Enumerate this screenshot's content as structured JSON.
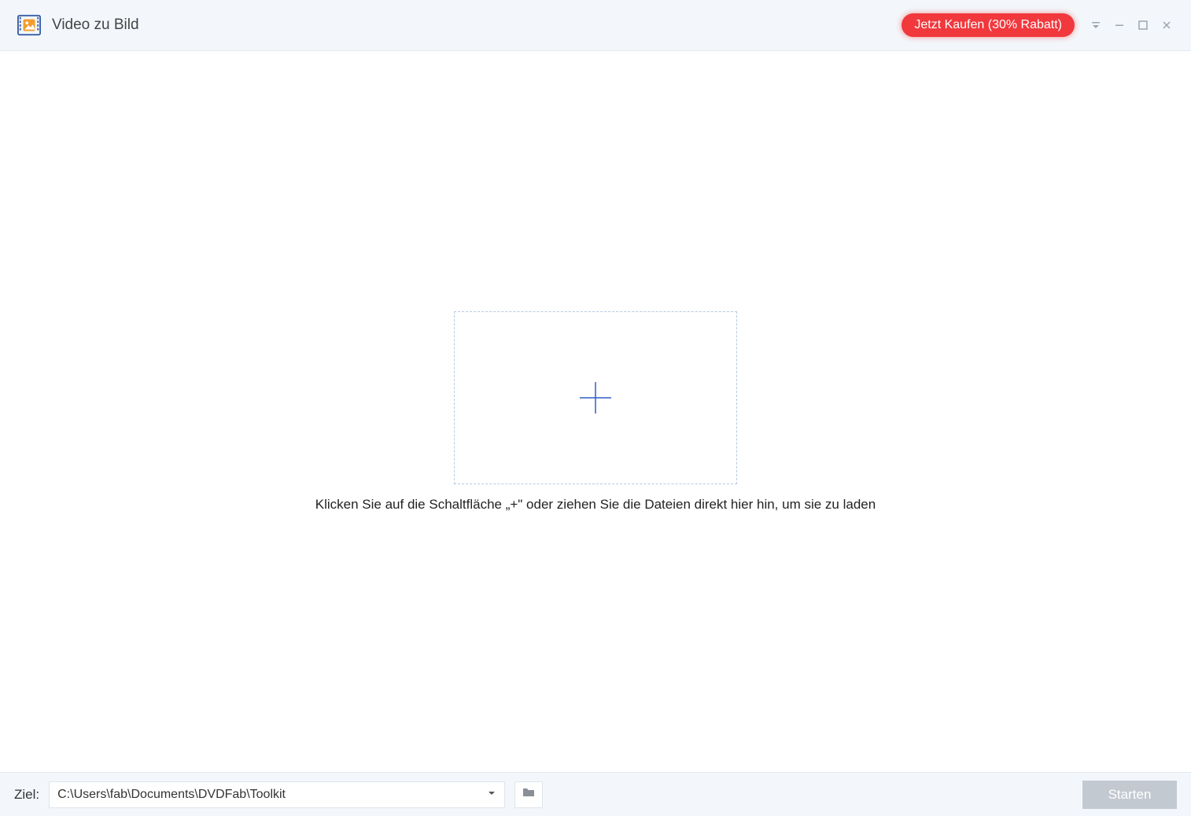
{
  "titlebar": {
    "app_title": "Video zu Bild",
    "buy_label": "Jetzt Kaufen (30% Rabatt)"
  },
  "main": {
    "instruction": "Klicken Sie auf die Schaltfläche „+\" oder ziehen Sie die Dateien direkt hier hin, um sie zu laden"
  },
  "footer": {
    "dest_label": "Ziel:",
    "dest_path": "C:\\Users\\fab\\Documents\\DVDFab\\Toolkit",
    "start_label": "Starten"
  },
  "colors": {
    "accent_red": "#f1383d",
    "accent_blue": "#2f5fc9",
    "panel_bg": "#f3f7fb",
    "disabled_btn": "#c3c9d1"
  }
}
